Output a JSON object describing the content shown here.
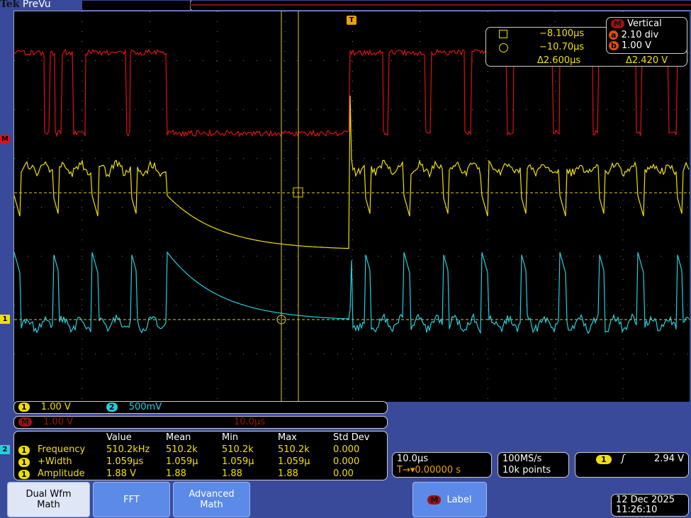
{
  "header": {
    "brand": "Tek",
    "mode": "PreVu"
  },
  "cursors": {
    "time_a": "−8.100µs",
    "time_b": "−10.70µs",
    "delta_t": "Δ2.600µs",
    "delta_v": "Δ2.420 V"
  },
  "vertical": {
    "title": "Vertical",
    "source": "M",
    "a_label": "a",
    "a_value": "2.10 div",
    "b_label": "b",
    "b_value": "1.00 V"
  },
  "channels": {
    "ch1_label": "1",
    "ch1_scale": "1.00 V",
    "ch2_label": "2",
    "ch2_scale": "500mV",
    "math_label": "M",
    "math_scale": "1.00 V",
    "math_time": "10.0µs"
  },
  "markers": {
    "math": "M",
    "ch1": "1",
    "ch2": "2",
    "trigger": "T"
  },
  "measurements": {
    "headers": [
      "Value",
      "Mean",
      "Min",
      "Max",
      "Std Dev"
    ],
    "rows": [
      {
        "src": "1",
        "name": "Frequency",
        "value": "510.2kHz",
        "mean": "510.2k",
        "min": "510.2k",
        "max": "510.2k",
        "std": "0.000"
      },
      {
        "src": "1",
        "name": "+Width",
        "value": "1.059µs",
        "mean": "1.059µ",
        "min": "1.059µ",
        "max": "1.059µ",
        "std": "0.000"
      },
      {
        "src": "1",
        "name": "Amplitude",
        "value": "1.88 V",
        "mean": "1.88",
        "min": "1.88",
        "max": "1.88",
        "std": "0.00"
      }
    ]
  },
  "horizontal": {
    "scale": "10.0µs",
    "position": "0.00000 s"
  },
  "acquisition": {
    "rate": "100MS/s",
    "length": "10k points"
  },
  "trigger": {
    "source": "1",
    "slope": "rising",
    "slope_glyph": "ʃ",
    "level": "2.94 V"
  },
  "buttons": {
    "dual": "Dual Wfm\nMath",
    "fft": "FFT",
    "adv": "Advanced\nMath",
    "label": "Label"
  },
  "datetime": {
    "date": "12 Dec  2025",
    "time": "11:26:10"
  },
  "colors": {
    "ch1": "#f0e000",
    "ch2": "#20d0e0",
    "math": "#e01010",
    "background": "#000000",
    "frame": "#3a4a9a"
  }
}
